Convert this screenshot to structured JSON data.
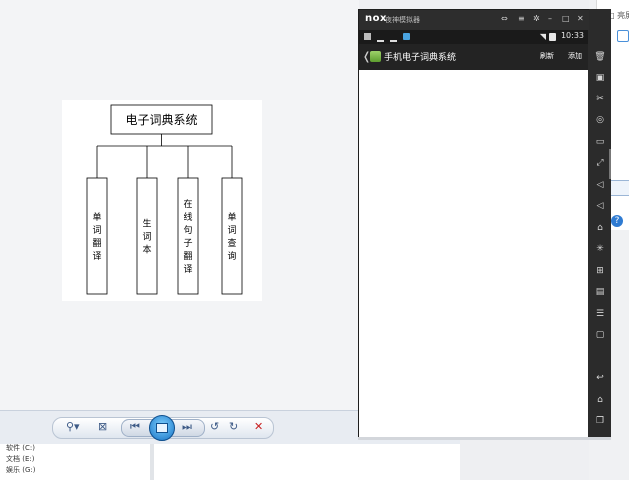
{
  "emulator": {
    "logo": "nox",
    "name": "夜神模拟器",
    "window_buttons": [
      "⇔",
      "≡",
      "✲",
      "–",
      "□",
      "✕"
    ]
  },
  "status_bar": {
    "time": "10:33"
  },
  "app": {
    "title": "手机电子词典系统",
    "refresh_label": "刷新",
    "add_label": "添加"
  },
  "diagram": {
    "root": "电子词典系统",
    "children": [
      [
        "单",
        "词",
        "翻",
        "译"
      ],
      [
        "生",
        "词",
        "本"
      ],
      [
        "在",
        "线",
        "句",
        "子",
        "翻",
        "译"
      ],
      [
        "单",
        "词",
        "查",
        "询"
      ]
    ]
  },
  "side_toolbar": {
    "icons": [
      "trash-icon",
      "apk-icon",
      "scissors-icon",
      "location-icon",
      "keyboard-icon",
      "fullscreen-icon",
      "volume-up-icon",
      "volume-down-icon",
      "screenshot-icon",
      "shake-icon",
      "multi-instance-icon",
      "record-icon",
      "more-icon",
      "settings-icon",
      "back-icon",
      "home-icon",
      "recent-apps-icon"
    ]
  },
  "viewer_toolbar": {
    "zoom": "⚲▾",
    "fit": "⊠",
    "prev": "⏮",
    "next": "⏭",
    "rotate_ccw": "↺",
    "rotate_cw": "↻",
    "delete": "✕"
  },
  "file_tree": {
    "items": [
      "软件 (C:)",
      "文档 (E:)",
      "娱乐 (G:)"
    ]
  },
  "right_strip": {
    "text": "□ 亮屏设置"
  }
}
